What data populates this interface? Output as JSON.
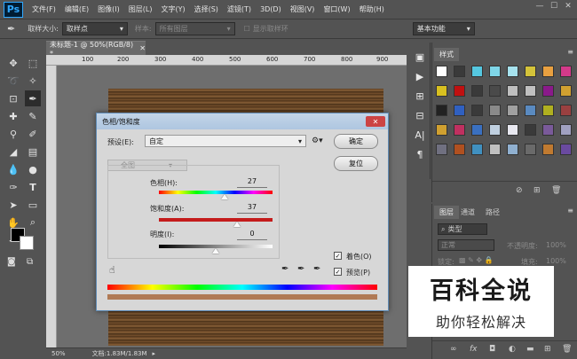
{
  "app": {
    "logo": "Ps",
    "menu": [
      "文件(F)",
      "编辑(E)",
      "图像(I)",
      "图层(L)",
      "文字(Y)",
      "选择(S)",
      "滤镜(T)",
      "3D(D)",
      "视图(V)",
      "窗口(W)",
      "帮助(H)"
    ],
    "window_controls": [
      "—",
      "☐",
      "✕"
    ]
  },
  "options_bar": {
    "sample_size_label": "取样大小:",
    "sample_size_value": "取样点",
    "sample_label": "样本:",
    "sample_value": "所有图层",
    "show_ring_label": "显示取样环",
    "workspace": "基本功能"
  },
  "document": {
    "tab_title": "未标题-1 @ 50%(RGB/8) *",
    "ruler_ticks": [
      "100",
      "200",
      "300",
      "400",
      "500",
      "600",
      "700",
      "800",
      "900"
    ],
    "zoom": "50%",
    "doc_size": "文档:1.83M/1.83M"
  },
  "dialog": {
    "title": "色相/饱和度",
    "preset_label": "预设(E):",
    "preset_value": "自定",
    "channel_value": "全图",
    "ok_label": "确定",
    "reset_label": "复位",
    "hue_label": "色相(H):",
    "hue_value": "27",
    "sat_label": "饱和度(A):",
    "sat_value": "37",
    "light_label": "明度(I):",
    "light_value": "0",
    "colorize_label": "着色(O)",
    "preview_label": "预览(P)"
  },
  "styles_panel": {
    "tab": "样式"
  },
  "layers_panel": {
    "tabs": [
      "图层",
      "通道",
      "路径"
    ],
    "filter_label": "类型",
    "blend_mode": "正常",
    "opacity_label": "不透明度:",
    "opacity_value": "100%",
    "lock_label": "锁定:",
    "fill_label": "填充:",
    "fill_value": "100%"
  },
  "watermark": {
    "line1": "百科全说",
    "line2": "助你轻松解决"
  },
  "colors": {
    "ui_bg": "#535353",
    "dialog_bg": "#d7d7d7",
    "title_bar": "#aec6e0",
    "logo_blue": "#31a8ff"
  }
}
